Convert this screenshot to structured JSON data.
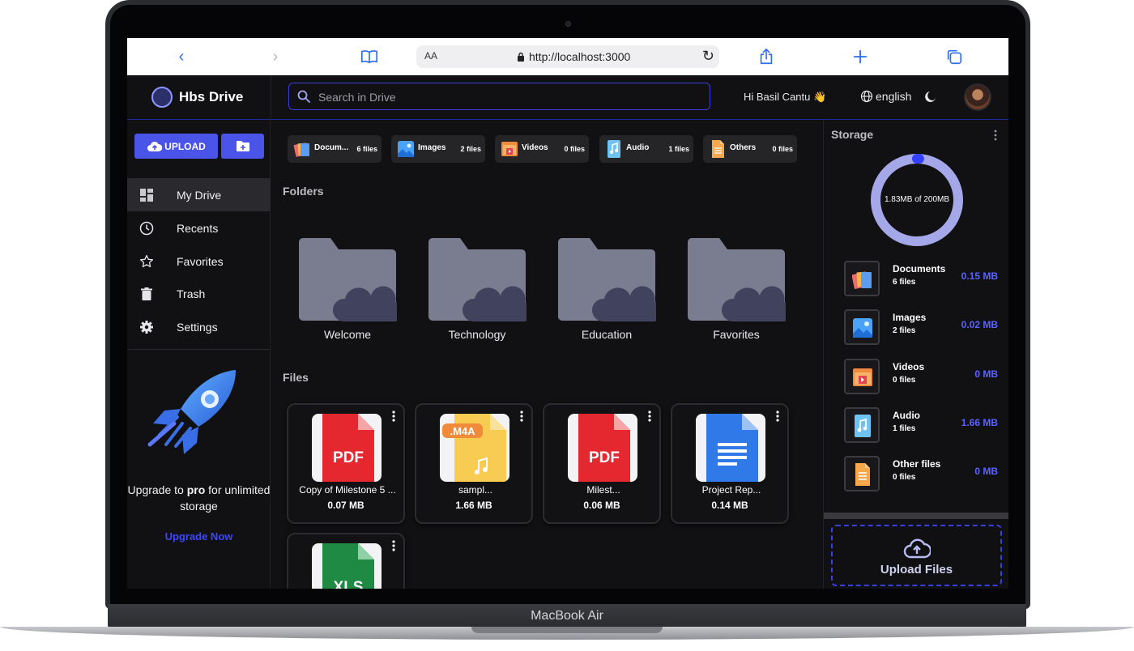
{
  "device": {
    "label": "MacBook Air"
  },
  "browser": {
    "url": "http://localhost:3000",
    "text_size_label": "AA"
  },
  "app": {
    "name": "Hbs Drive"
  },
  "header": {
    "search_placeholder": "Search in Drive",
    "greeting": "Hi Basil Cantu 👋",
    "language": "english"
  },
  "sidebar": {
    "upload_label": "UPLOAD",
    "nav": [
      {
        "label": "My Drive",
        "icon": "dashboard-icon",
        "active": true
      },
      {
        "label": "Recents",
        "icon": "clock-icon"
      },
      {
        "label": "Favorites",
        "icon": "star-icon"
      },
      {
        "label": "Trash",
        "icon": "trash-icon"
      },
      {
        "label": "Settings",
        "icon": "gear-icon"
      }
    ],
    "upgrade_pre": "Upgrade to ",
    "upgrade_bold": "pro",
    "upgrade_post": " for unlimited storage",
    "upgrade_link": "Upgrade Now"
  },
  "categories": [
    {
      "label": "Docum...",
      "count": "6 files",
      "icon": "documents-icon"
    },
    {
      "label": "Images",
      "count": "2 files",
      "icon": "images-icon"
    },
    {
      "label": "Videos",
      "count": "0 files",
      "icon": "videos-icon"
    },
    {
      "label": "Audio",
      "count": "1 files",
      "icon": "audio-icon"
    },
    {
      "label": "Others",
      "count": "0 files",
      "icon": "others-icon"
    }
  ],
  "folders_title": "Folders",
  "folders": [
    {
      "name": "Welcome"
    },
    {
      "name": "Technology"
    },
    {
      "name": "Education"
    },
    {
      "name": "Favorites"
    }
  ],
  "files_title": "Files",
  "files": [
    {
      "name": "Copy of Milestone 5 ...",
      "size": "0.07 MB",
      "type": "PDF"
    },
    {
      "name": "sampl...",
      "size": "1.66 MB",
      "type": ".M4A"
    },
    {
      "name": "Milest...",
      "size": "0.06 MB",
      "type": "PDF"
    },
    {
      "name": "Project Rep...",
      "size": "0.14 MB",
      "type": "DOC"
    },
    {
      "name": "",
      "size": "",
      "type": "XLS"
    }
  ],
  "storage": {
    "title": "Storage",
    "usage_label": "1.83MB of 200MB",
    "used_fraction": 0.00915,
    "colors": {
      "track": "#a4a8e8",
      "used": "#3440ff"
    },
    "rows": [
      {
        "name": "Documents",
        "count": "6 files",
        "size": "0.15 MB",
        "icon": "documents-icon"
      },
      {
        "name": "Images",
        "count": "2 files",
        "size": "0.02 MB",
        "icon": "images-icon"
      },
      {
        "name": "Videos",
        "count": "0 files",
        "size": "0 MB",
        "icon": "videos-icon"
      },
      {
        "name": "Audio",
        "count": "1 files",
        "size": "1.66 MB",
        "icon": "audio-icon"
      },
      {
        "name": "Other files",
        "count": "0 files",
        "size": "0 MB",
        "icon": "others-icon"
      }
    ],
    "upload_label": "Upload Files"
  }
}
